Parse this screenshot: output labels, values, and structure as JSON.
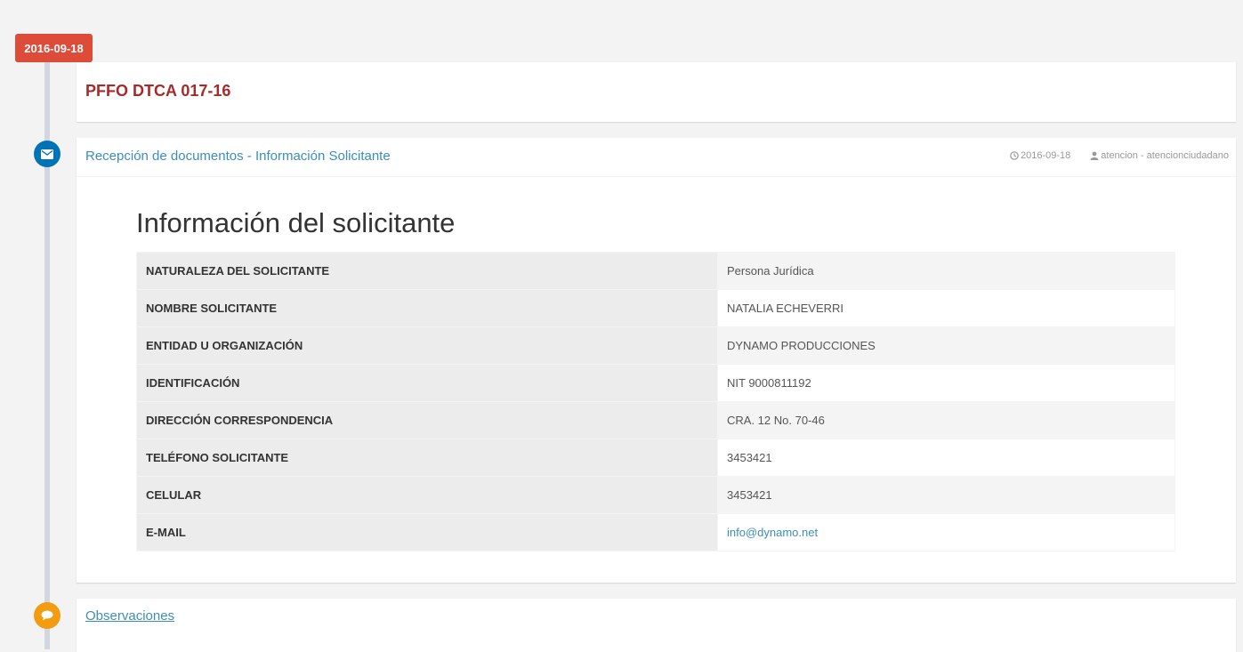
{
  "timeline": {
    "date_label": "2016-09-18"
  },
  "case": {
    "title": "PFFO DTCA 017-16"
  },
  "event": {
    "title": "Recepción de documentos - Información Solicitante",
    "icon": "envelope-icon",
    "date": "2016-09-18",
    "user": "atencion - atencionciudadano",
    "date_icon": "clock-icon",
    "user_icon": "user-icon"
  },
  "section": {
    "title": "Información del solicitante"
  },
  "info_table": [
    {
      "label": "NATURALEZA DEL SOLICITANTE",
      "value": "Persona Jurídica"
    },
    {
      "label": "NOMBRE SOLICITANTE",
      "value": "NATALIA ECHEVERRI"
    },
    {
      "label": "ENTIDAD U ORGANIZACIÓN",
      "value": "DYNAMO PRODUCCIONES"
    },
    {
      "label": "IDENTIFICACIÓN",
      "value": "NIT 9000811192"
    },
    {
      "label": "DIRECCIÓN CORRESPONDENCIA",
      "value": "CRA. 12 No. 70-46"
    },
    {
      "label": "TELÉFONO SOLICITANTE",
      "value": "3453421"
    },
    {
      "label": "CELULAR",
      "value": "3453421"
    },
    {
      "label": "E-MAIL",
      "value": "info@dynamo.net"
    }
  ],
  "observations": {
    "title": "Observaciones",
    "icon": "comments-icon"
  },
  "colors": {
    "date_label_bg": "#dd4b39",
    "case_title": "#a52a2a",
    "link": "#3c8dbc",
    "circle_blue": "#0073b7",
    "circle_orange": "#f39c12"
  }
}
